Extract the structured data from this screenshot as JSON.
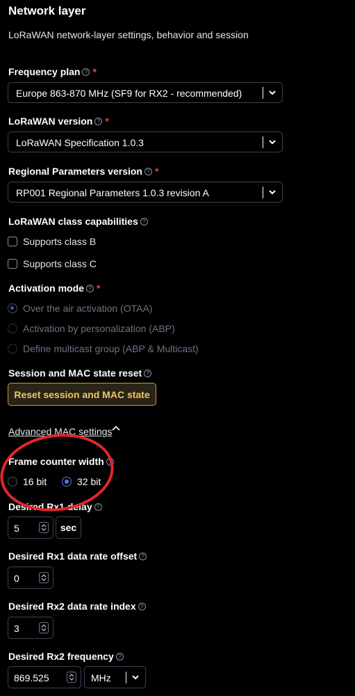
{
  "header": {
    "title": "Network layer",
    "subtitle": "LoRaWAN network-layer settings, behavior and session"
  },
  "frequency_plan": {
    "label": "Frequency plan",
    "required": "*",
    "value": "Europe 863-870 MHz (SF9 for RX2 - recommended)"
  },
  "lorawan_version": {
    "label": "LoRaWAN version",
    "required": "*",
    "value": "LoRaWAN Specification 1.0.3"
  },
  "regional_params": {
    "label": "Regional Parameters version",
    "required": "*",
    "value": "RP001 Regional Parameters 1.0.3 revision A"
  },
  "class_caps": {
    "label": "LoRaWAN class capabilities",
    "options": [
      "Supports class B",
      "Supports class C"
    ]
  },
  "activation": {
    "label": "Activation mode",
    "required": "*",
    "options": [
      "Over the air activation (OTAA)",
      "Activation by personalization (ABP)",
      "Define multicast group (ABP & Multicast)"
    ],
    "selected": "Over the air activation (OTAA)"
  },
  "session_reset": {
    "label": "Session and MAC state reset",
    "button": "Reset session and MAC state"
  },
  "advanced": {
    "link": "Advanced MAC settings"
  },
  "frame_counter": {
    "label": "Frame counter width",
    "options": [
      "16 bit",
      "32 bit"
    ],
    "selected": "32 bit"
  },
  "rx1_delay": {
    "label": "Desired Rx1 delay",
    "value": "5",
    "unit": "sec"
  },
  "rx1_dr_offset": {
    "label": "Desired Rx1 data rate offset",
    "value": "0"
  },
  "rx2_dr_index": {
    "label": "Desired Rx2 data rate index",
    "value": "3"
  },
  "rx2_frequency": {
    "label": "Desired Rx2 frequency",
    "value": "869.525",
    "unit": "MHz"
  },
  "colors": {
    "background": "#000000",
    "required": "#e5484d",
    "accent": "#4a7df0",
    "warning_button": "#c99a3a",
    "annotation": "#e3262b"
  }
}
